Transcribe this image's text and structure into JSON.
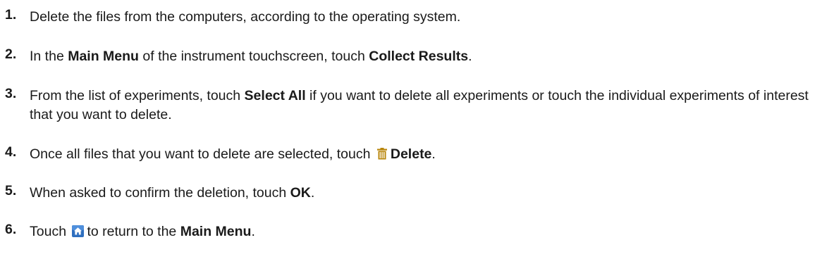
{
  "colors": {
    "text": "#1a1a1a",
    "trash_icon": "#b8860b",
    "home_icon_bg": "#2f6fbf",
    "home_icon_fg": "#ffffff"
  },
  "steps": [
    {
      "number": "1.",
      "parts": [
        "Delete the files from the computers, according to the operating system."
      ]
    },
    {
      "number": "2.",
      "parts": [
        "In the ",
        "Main Menu",
        " of the instrument touchscreen, touch ",
        "Collect Results",
        "."
      ]
    },
    {
      "number": "3.",
      "parts": [
        "From the list of experiments, touch ",
        "Select All",
        " if you want to delete all experiments or touch the individual experiments of interest that you want to delete."
      ]
    },
    {
      "number": "4.",
      "icon": "trash-icon",
      "parts": [
        "Once all files that you want to delete are selected, touch ",
        "Delete",
        "."
      ]
    },
    {
      "number": "5.",
      "parts": [
        "When asked to confirm the deletion, touch ",
        "OK",
        "."
      ]
    },
    {
      "number": "6.",
      "icon": "home-icon",
      "parts": [
        "Touch ",
        "to return to the ",
        "Main Menu",
        "."
      ]
    }
  ]
}
